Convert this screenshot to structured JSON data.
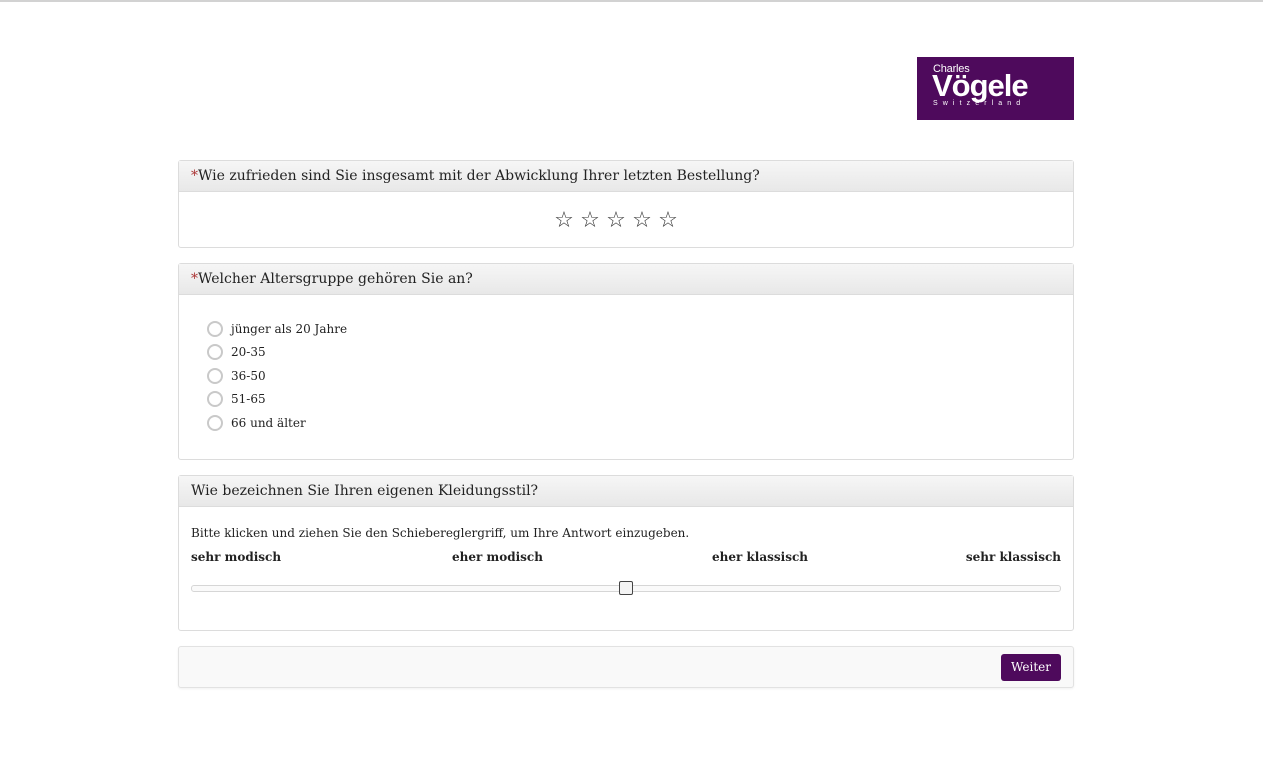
{
  "brand": {
    "line1": "Charles",
    "line2": "Vögele",
    "line3": "Switzerland",
    "color": "#4e0a5c"
  },
  "q1": {
    "required_mark": "*",
    "title": "Wie zufrieden sind Sie insgesamt mit der Abwicklung Ihrer letzten Bestellung?",
    "star_glyph": "☆",
    "rating_selected": 0,
    "rating_max": 5
  },
  "q2": {
    "required_mark": "*",
    "title": "Welcher Altersgruppe gehören Sie an?",
    "options": [
      "jünger als 20 Jahre",
      "20-35",
      "36-50",
      "51-65",
      "66 und älter"
    ]
  },
  "q3": {
    "title": "Wie bezeichnen Sie Ihren eigenen Kleidungsstil?",
    "instruction": "Bitte klicken und ziehen Sie den Schiebereglergriff, um Ihre Antwort einzugeben.",
    "labels": [
      "sehr modisch",
      "eher modisch",
      "eher klassisch",
      "sehr klassisch"
    ],
    "slider_value_fraction": 0.5
  },
  "footer": {
    "next_label": "Weiter"
  }
}
